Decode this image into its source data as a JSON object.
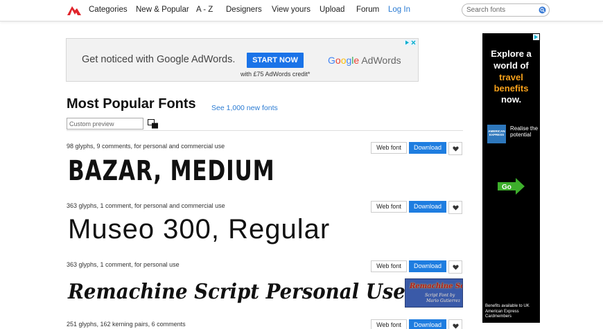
{
  "nav": {
    "items": [
      "Categories",
      "New & Popular",
      "A - Z",
      "Designers",
      "View yours",
      "Upload",
      "Forum"
    ],
    "login": "Log In",
    "search_placeholder": "Search fonts"
  },
  "ad_banner": {
    "headline": "Get noticed with Google AdWords.",
    "cta": "START NOW",
    "credit": "with £75 AdWords credit*",
    "brand_adwords": "AdWords",
    "brand_google": "Google"
  },
  "main": {
    "title": "Most Popular Fonts",
    "see_new": "See 1,000 new fonts",
    "preview_placeholder": "Custom preview"
  },
  "buttons": {
    "web_font": "Web font",
    "download": "Download"
  },
  "fonts": [
    {
      "meta": "98 glyphs, 9 comments, for personal and commercial use",
      "sample": "BAZAR, MEDIUM"
    },
    {
      "meta": "363 glyphs, 1 comment, for personal and commercial use",
      "sample": "Museo 300, Regular"
    },
    {
      "meta": "363 glyphs, 1 comment, for personal use",
      "sample": "Remachine Script Personal Use",
      "thumb": {
        "line1": "Remachine Script",
        "line2": "Script Font by",
        "line3": "Mario Gutierrez"
      }
    },
    {
      "meta": "251 glyphs, 162 kerning pairs, 6 comments"
    }
  ],
  "side_ad": {
    "line1": "Explore a",
    "line2": "world of",
    "line3": "travel",
    "line4": "benefits",
    "line5": "now.",
    "amex_text": "AMERICAN EXPRESS",
    "tagline": "Realise the potential",
    "go": "Go",
    "footer": "Benefits available to UK American Express Cardmembers"
  },
  "colors": {
    "link": "#2a7bd3",
    "download_button": "#1e7de0",
    "ad_cta": "#1a73e8",
    "logo": "#e0242b",
    "side_ad_accent": "#f6a01a",
    "go_arrow": "#3dae2b"
  }
}
